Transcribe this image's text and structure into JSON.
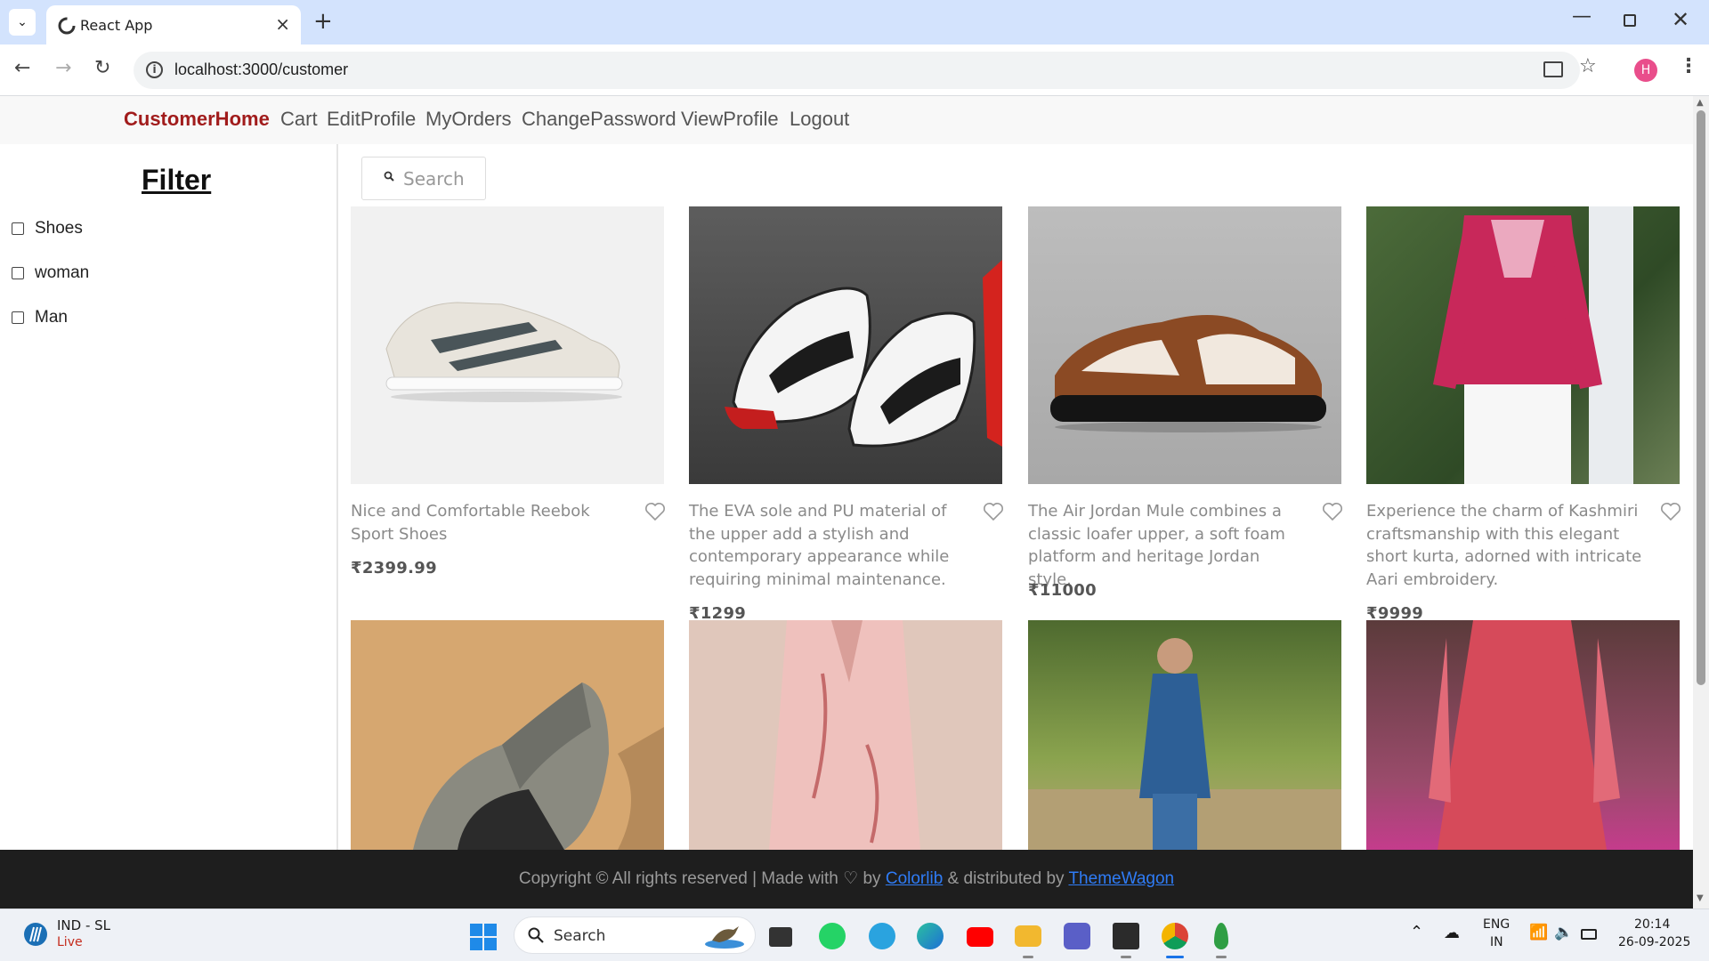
{
  "browser": {
    "tab_title": "React App",
    "url": "localhost:3000/customer",
    "profile_initial": "H"
  },
  "nav": {
    "links": [
      "CustomerHome",
      "Cart",
      "EditProfile",
      "MyOrders",
      "ChangePassword",
      "ViewProfile",
      "Logout"
    ],
    "active": "CustomerHome"
  },
  "filter": {
    "title": "Filter",
    "options": [
      "Shoes",
      "woman",
      "Man"
    ]
  },
  "search": {
    "placeholder": "Search"
  },
  "products": [
    {
      "description": "Nice and Comfortable Reebok Sport Shoes",
      "price": "₹2399.99"
    },
    {
      "description": "The EVA sole and PU material of the upper add a stylish and contemporary appearance while requiring minimal maintenance.",
      "price": "₹1299"
    },
    {
      "description": "The Air Jordan Mule combines a classic loafer upper, a soft foam platform and heritage Jordan style.",
      "price": "₹11000"
    },
    {
      "description": "Experience the charm of Kashmiri craftsmanship with this elegant short kurta, adorned with intricate Aari embroidery.",
      "price": "₹9999"
    }
  ],
  "footer": {
    "text_before": "Copyright © All rights reserved | Made with",
    "text_by": "by",
    "link1": "Colorlib",
    "text_mid": "& distributed by",
    "link2": "ThemeWagon"
  },
  "taskbar": {
    "weather_title": "IND - SL",
    "weather_sub": "Live",
    "search_label": "Search",
    "lang_line1": "ENG",
    "lang_line2": "IN",
    "time": "20:14",
    "date": "26-09-2025"
  },
  "colors": {
    "accent_nav": "#a11c1c",
    "link": "#2f7cf6",
    "footer_bg": "#1e1e1e"
  }
}
